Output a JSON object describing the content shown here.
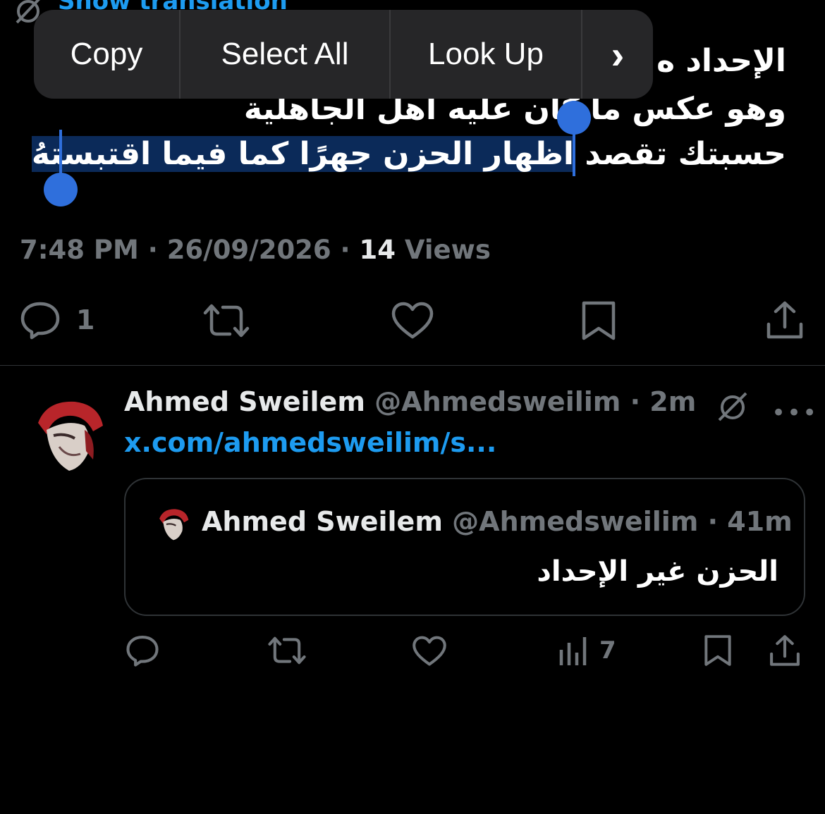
{
  "header": {
    "partial_link": "Show translation"
  },
  "context_menu": {
    "copy": "Copy",
    "select_all": "Select All",
    "look_up": "Look Up",
    "more": "›"
  },
  "tweet": {
    "line1_visible": "الإحداد ه",
    "line2": "وهو عكس ما كان عليه أهل الجاهلية",
    "line3_plain": "حسبتك تقصد ",
    "line3_selected": "اظهار الحزن جهرًا كما فيما اقتبستهُ",
    "time": "7:48 PM",
    "date": "26/09/2026",
    "views_count": "14",
    "views_label": "Views",
    "reply_count": "1"
  },
  "reply": {
    "name": "Ahmed Sweilem",
    "handle": "@Ahmedsweilim",
    "age": "2m",
    "link": "x.com/ahmedsweilim/s...",
    "more": "•••",
    "views_count": "7",
    "quote": {
      "name": "Ahmed Sweilem",
      "handle": "@Ahmedsweilim",
      "age": "41m",
      "text": "الحزن غير الإحداد"
    }
  },
  "colors": {
    "accent": "#1d9bf0",
    "selection": "#2f6fdc",
    "muted": "#71767b"
  }
}
